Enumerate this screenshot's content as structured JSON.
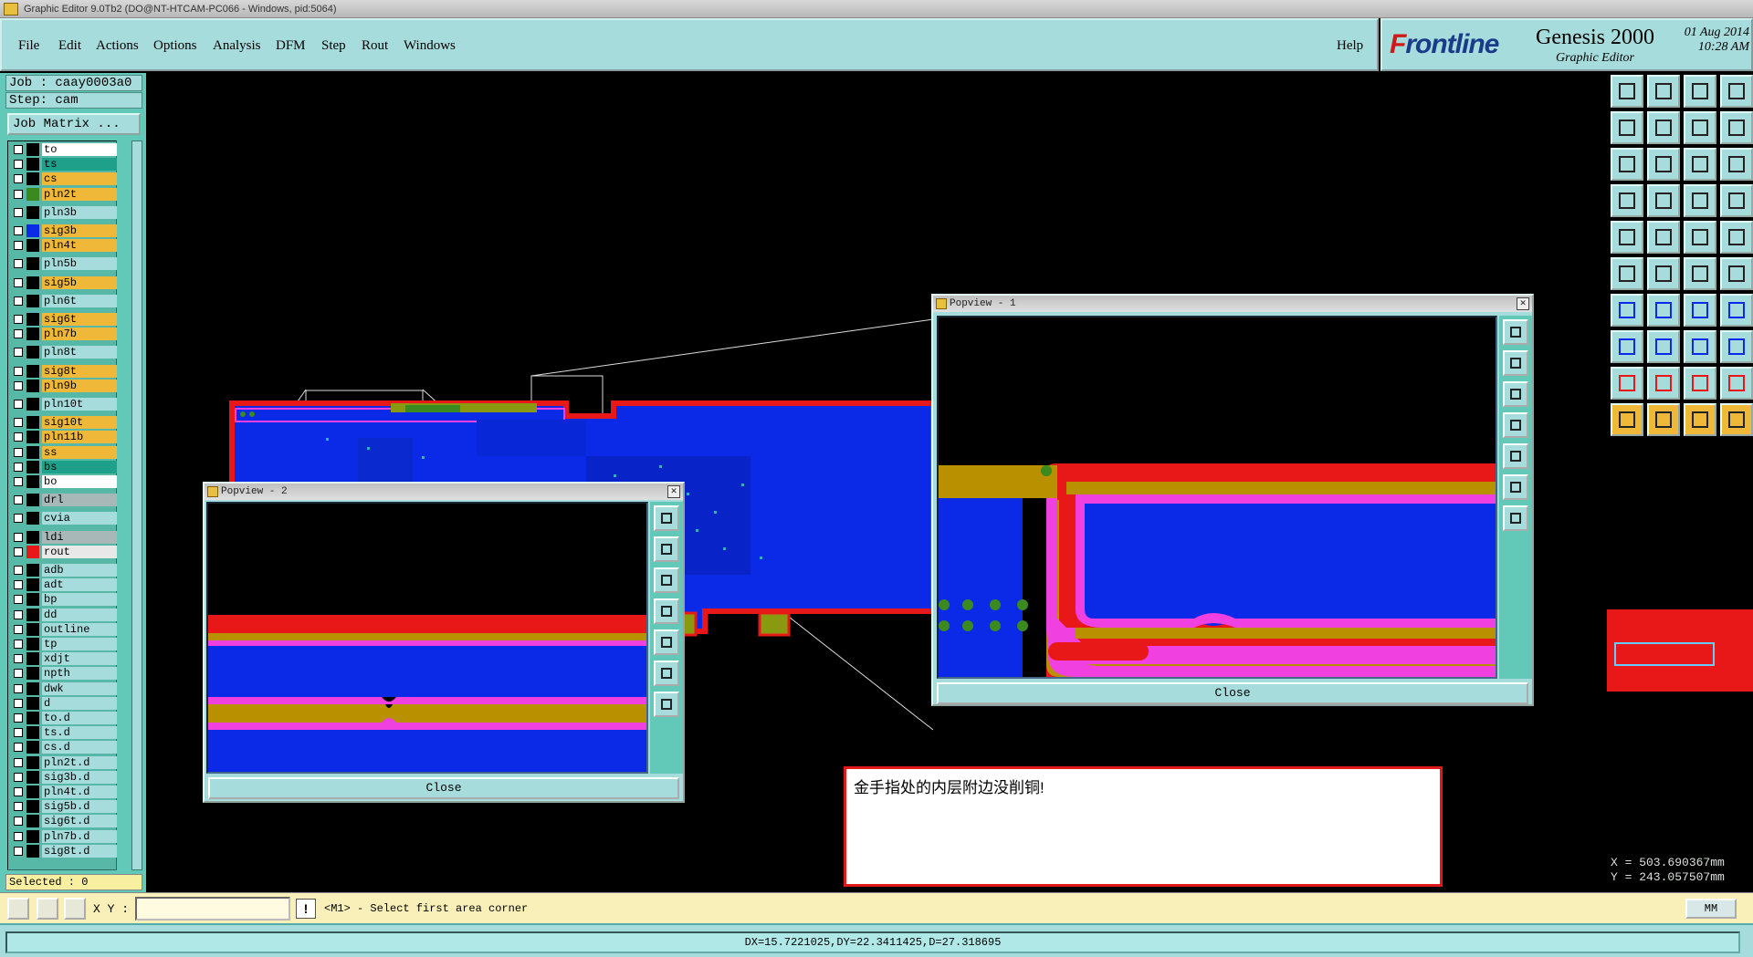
{
  "window": {
    "title": "Graphic Editor 9.0Tb2 (DO@NT-HTCAM-PC066 - Windows, pid:5064)"
  },
  "menu": {
    "items": [
      "File",
      "Edit",
      "Actions",
      "Options",
      "Analysis",
      "DFM",
      "Step",
      "Rout",
      "Windows"
    ],
    "help": "Help"
  },
  "brand": {
    "logo_prefix": "F",
    "logo_rest": "rontline",
    "product": "Genesis 2000",
    "subtitle": "Graphic Editor",
    "date": "01 Aug 2014",
    "time": "10:28 AM"
  },
  "job": {
    "job_label": "Job : caay0003a0",
    "step_label": "Step: cam",
    "matrix_button": "Job Matrix ..."
  },
  "layers": [
    {
      "name": "to",
      "color": "#ffffff",
      "swatch": "#000000"
    },
    {
      "name": "ts",
      "color": "#1ea08a",
      "swatch": "#000000"
    },
    {
      "name": "cs",
      "color": "#f0b838",
      "swatch": "#000000"
    },
    {
      "name": "pln2t",
      "color": "#f0b838",
      "swatch": "#3a8a20"
    },
    {
      "name": "pln3b",
      "color": "#a6dcdc",
      "swatch": "#000000"
    },
    {
      "name": "sig3b",
      "color": "#f0b838",
      "swatch": "#0a2ae8"
    },
    {
      "name": "pln4t",
      "color": "#f0b838",
      "swatch": "#000000"
    },
    {
      "name": "pln5b",
      "color": "#a6dcdc",
      "swatch": "#000000"
    },
    {
      "name": "sig5b",
      "color": "#f0b838",
      "swatch": "#000000"
    },
    {
      "name": "pln6t",
      "color": "#a6dcdc",
      "swatch": "#000000"
    },
    {
      "name": "sig6t",
      "color": "#f0b838",
      "swatch": "#000000"
    },
    {
      "name": "pln7b",
      "color": "#f0b838",
      "swatch": "#000000"
    },
    {
      "name": "pln8t",
      "color": "#a6dcdc",
      "swatch": "#000000"
    },
    {
      "name": "sig8t",
      "color": "#f0b838",
      "swatch": "#000000"
    },
    {
      "name": "pln9b",
      "color": "#f0b838",
      "swatch": "#000000"
    },
    {
      "name": "pln10t",
      "color": "#a6dcdc",
      "swatch": "#000000"
    },
    {
      "name": "sig10t",
      "color": "#f0b838",
      "swatch": "#000000"
    },
    {
      "name": "pln11b",
      "color": "#f0b838",
      "swatch": "#000000"
    },
    {
      "name": "ss",
      "color": "#f0b838",
      "swatch": "#000000"
    },
    {
      "name": "bs",
      "color": "#1ea08a",
      "swatch": "#000000"
    },
    {
      "name": "bo",
      "color": "#ffffff",
      "swatch": "#000000"
    },
    {
      "name": "drl",
      "color": "#a8b8b8",
      "swatch": "#000000"
    },
    {
      "name": "cvia",
      "color": "#a6dcdc",
      "swatch": "#000000"
    },
    {
      "name": "ldi",
      "color": "#a8b8b8",
      "swatch": "#000000"
    },
    {
      "name": "rout",
      "color": "#e8e8e8",
      "swatch": "#e81818"
    },
    {
      "name": "adb",
      "color": "#a6dcdc",
      "swatch": "#000000"
    },
    {
      "name": "adt",
      "color": "#a6dcdc",
      "swatch": "#000000"
    },
    {
      "name": "bp",
      "color": "#a6dcdc",
      "swatch": "#000000"
    },
    {
      "name": "dd",
      "color": "#a6dcdc",
      "swatch": "#000000"
    },
    {
      "name": "outline",
      "color": "#a6dcdc",
      "swatch": "#000000"
    },
    {
      "name": "tp",
      "color": "#a6dcdc",
      "swatch": "#000000"
    },
    {
      "name": "xdjt",
      "color": "#a6dcdc",
      "swatch": "#000000"
    },
    {
      "name": "npth",
      "color": "#a6dcdc",
      "swatch": "#000000"
    },
    {
      "name": "dwk",
      "color": "#a6dcdc",
      "swatch": "#000000"
    },
    {
      "name": "d",
      "color": "#a6dcdc",
      "swatch": "#000000"
    },
    {
      "name": "to.d",
      "color": "#a6dcdc",
      "swatch": "#000000"
    },
    {
      "name": "ts.d",
      "color": "#a6dcdc",
      "swatch": "#000000"
    },
    {
      "name": "cs.d",
      "color": "#a6dcdc",
      "swatch": "#000000"
    },
    {
      "name": "pln2t.d",
      "color": "#a6dcdc",
      "swatch": "#000000"
    },
    {
      "name": "sig3b.d",
      "color": "#a6dcdc",
      "swatch": "#000000"
    },
    {
      "name": "pln4t.d",
      "color": "#a6dcdc",
      "swatch": "#000000"
    },
    {
      "name": "sig5b.d",
      "color": "#a6dcdc",
      "swatch": "#000000"
    },
    {
      "name": "sig6t.d",
      "color": "#a6dcdc",
      "swatch": "#000000"
    },
    {
      "name": "pln7b.d",
      "color": "#a6dcdc",
      "swatch": "#000000"
    },
    {
      "name": "sig8t.d",
      "color": "#a6dcdc",
      "swatch": "#000000"
    }
  ],
  "selected": "Selected : 0",
  "popview1": {
    "title": "Popview - 1",
    "close": "Close"
  },
  "popview2": {
    "title": "Popview - 2",
    "close": "Close"
  },
  "note": "金手指处的内层附边没削铜!",
  "coords": {
    "x": "X = 503.690367mm",
    "y": "Y = 243.057507mm"
  },
  "status": {
    "xy_label": "X Y :",
    "xy_value": "",
    "alert": "!",
    "prompt": "<M1> - Select first area corner",
    "units": "MM"
  },
  "measure": "DX=15.7221025,DY=22.3411425,D=27.318695",
  "colors": {
    "panel": "#a6dcdc",
    "dark_panel": "#62c8b8",
    "copper": "#0a2ae8",
    "outline": "#e81818",
    "mask": "#b89000",
    "pink": "#f040e0"
  },
  "icons": [
    "zoom-home-icon",
    "zoom-in-icon",
    "home-icon",
    "layout-icon",
    "pan-left-icon",
    "pan-right-icon",
    "rotate-icon",
    "snap-icon",
    "zoom-fit-icon",
    "center-icon",
    "one-to-one-icon",
    "help-icon",
    "measure-icon",
    "pad-icon",
    "align-icon",
    "distribute-icon",
    "select-icon",
    "filter-icon",
    "line-icon",
    "circle-icon",
    "net-icon",
    "cross-icon",
    "node-icon",
    "link-icon",
    "draw-line-icon",
    "draw-arc-icon",
    "undo-icon",
    "slot-icon",
    "move-icon",
    "trim-icon",
    "copy-icon",
    "group-icon",
    "triangle-icon",
    "triangle-a-icon",
    "triangle-b-icon",
    "triangle-c-icon",
    "pointer-icon",
    "pointer-red-icon",
    "pointer-move-icon",
    "pointer-multi-icon"
  ]
}
